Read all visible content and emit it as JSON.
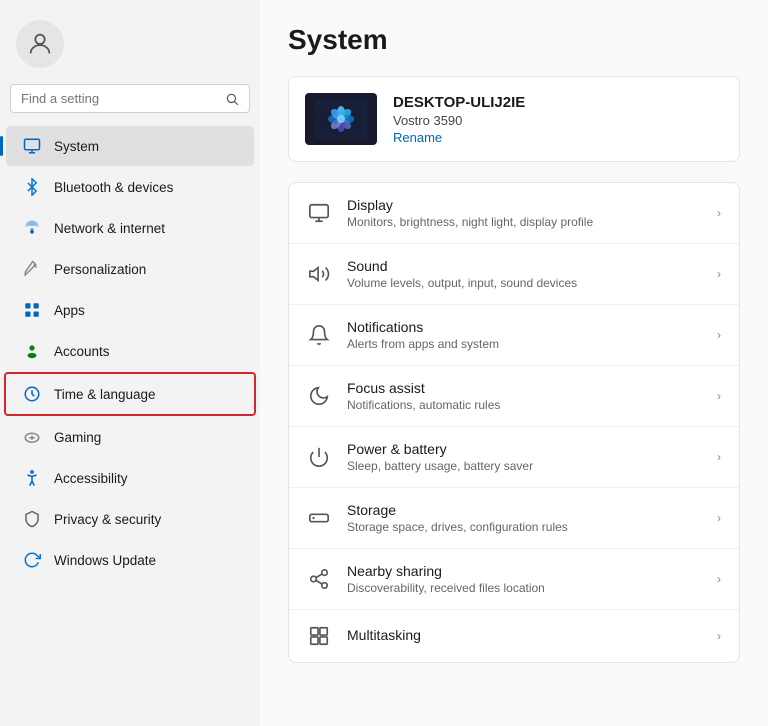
{
  "sidebar": {
    "search_placeholder": "Find a setting",
    "nav_items": [
      {
        "id": "system",
        "label": "System",
        "icon": "system",
        "active": true
      },
      {
        "id": "bluetooth",
        "label": "Bluetooth & devices",
        "icon": "bluetooth",
        "active": false
      },
      {
        "id": "network",
        "label": "Network & internet",
        "icon": "network",
        "active": false
      },
      {
        "id": "personalization",
        "label": "Personalization",
        "icon": "personalization",
        "active": false
      },
      {
        "id": "apps",
        "label": "Apps",
        "icon": "apps",
        "active": false
      },
      {
        "id": "accounts",
        "label": "Accounts",
        "icon": "accounts",
        "active": false
      },
      {
        "id": "time",
        "label": "Time & language",
        "icon": "time",
        "active": false,
        "highlighted": true
      },
      {
        "id": "gaming",
        "label": "Gaming",
        "icon": "gaming",
        "active": false
      },
      {
        "id": "accessibility",
        "label": "Accessibility",
        "icon": "accessibility",
        "active": false
      },
      {
        "id": "privacy",
        "label": "Privacy & security",
        "icon": "privacy",
        "active": false
      },
      {
        "id": "update",
        "label": "Windows Update",
        "icon": "update",
        "active": false
      }
    ]
  },
  "main": {
    "title": "System",
    "device": {
      "name": "DESKTOP-ULIJ2IE",
      "model": "Vostro 3590",
      "rename_label": "Rename"
    },
    "settings_items": [
      {
        "id": "display",
        "label": "Display",
        "desc": "Monitors, brightness, night light, display profile"
      },
      {
        "id": "sound",
        "label": "Sound",
        "desc": "Volume levels, output, input, sound devices"
      },
      {
        "id": "notifications",
        "label": "Notifications",
        "desc": "Alerts from apps and system"
      },
      {
        "id": "focus",
        "label": "Focus assist",
        "desc": "Notifications, automatic rules"
      },
      {
        "id": "power",
        "label": "Power & battery",
        "desc": "Sleep, battery usage, battery saver"
      },
      {
        "id": "storage",
        "label": "Storage",
        "desc": "Storage space, drives, configuration rules"
      },
      {
        "id": "nearby",
        "label": "Nearby sharing",
        "desc": "Discoverability, received files location"
      },
      {
        "id": "multitasking",
        "label": "Multitasking",
        "desc": ""
      }
    ]
  }
}
